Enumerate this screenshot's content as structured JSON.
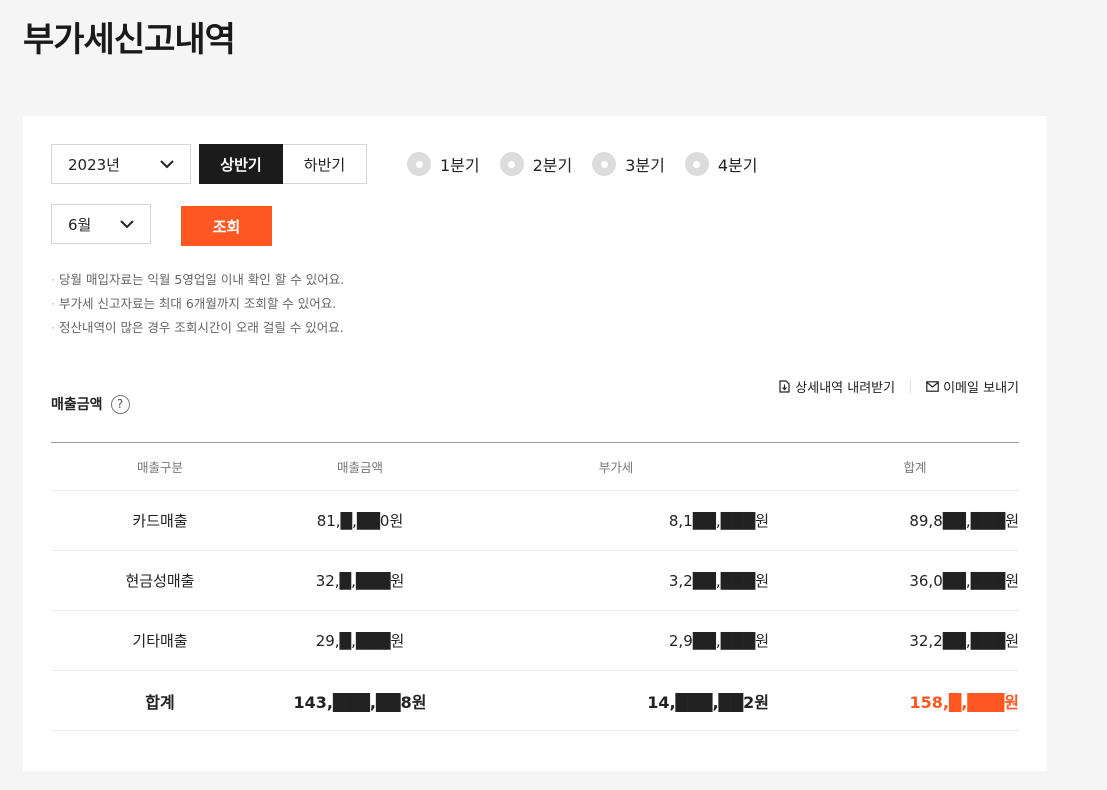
{
  "page_title": "부가세신고내역",
  "filters": {
    "year": "2023년",
    "half_options": [
      "상반기",
      "하반기"
    ],
    "half_selected": "상반기",
    "quarters": [
      "1분기",
      "2분기",
      "3분기",
      "4분기"
    ],
    "month": "6월",
    "search_label": "조회"
  },
  "notes": [
    "당월 매입자료는 익월 5영업일 이내 확인 할 수 있어요.",
    "부가세 신고자료는 최대 6개월까지 조회할 수 있어요.",
    "정산내역이 많은 경우 조회시간이 오래 걸릴 수 있어요."
  ],
  "section": {
    "title": "매출금액",
    "help": "?",
    "download_label": "상세내역 내려받기",
    "email_label": "이메일 보내기"
  },
  "table": {
    "headers": [
      "매출구분",
      "매출금액",
      "부가세",
      "합계"
    ],
    "rows": [
      {
        "type": "카드매출",
        "amount": "81,█,██0원",
        "vat": "8,1██,███원",
        "total": "89,8██,███원"
      },
      {
        "type": "현금성매출",
        "amount": "32,█,███원",
        "vat": "3,2██,███원",
        "total": "36,0██,███원"
      },
      {
        "type": "기타매출",
        "amount": "29,█,███원",
        "vat": "2,9██,███원",
        "total": "32,2██,███원"
      }
    ],
    "total": {
      "type": "합계",
      "amount": "143,███,██8원",
      "vat": "14,███,██2원",
      "total": "158,█,███원"
    }
  },
  "colors": {
    "accent": "#ff5722",
    "dark": "#1b1b1b",
    "background": "#f5f5f5"
  }
}
